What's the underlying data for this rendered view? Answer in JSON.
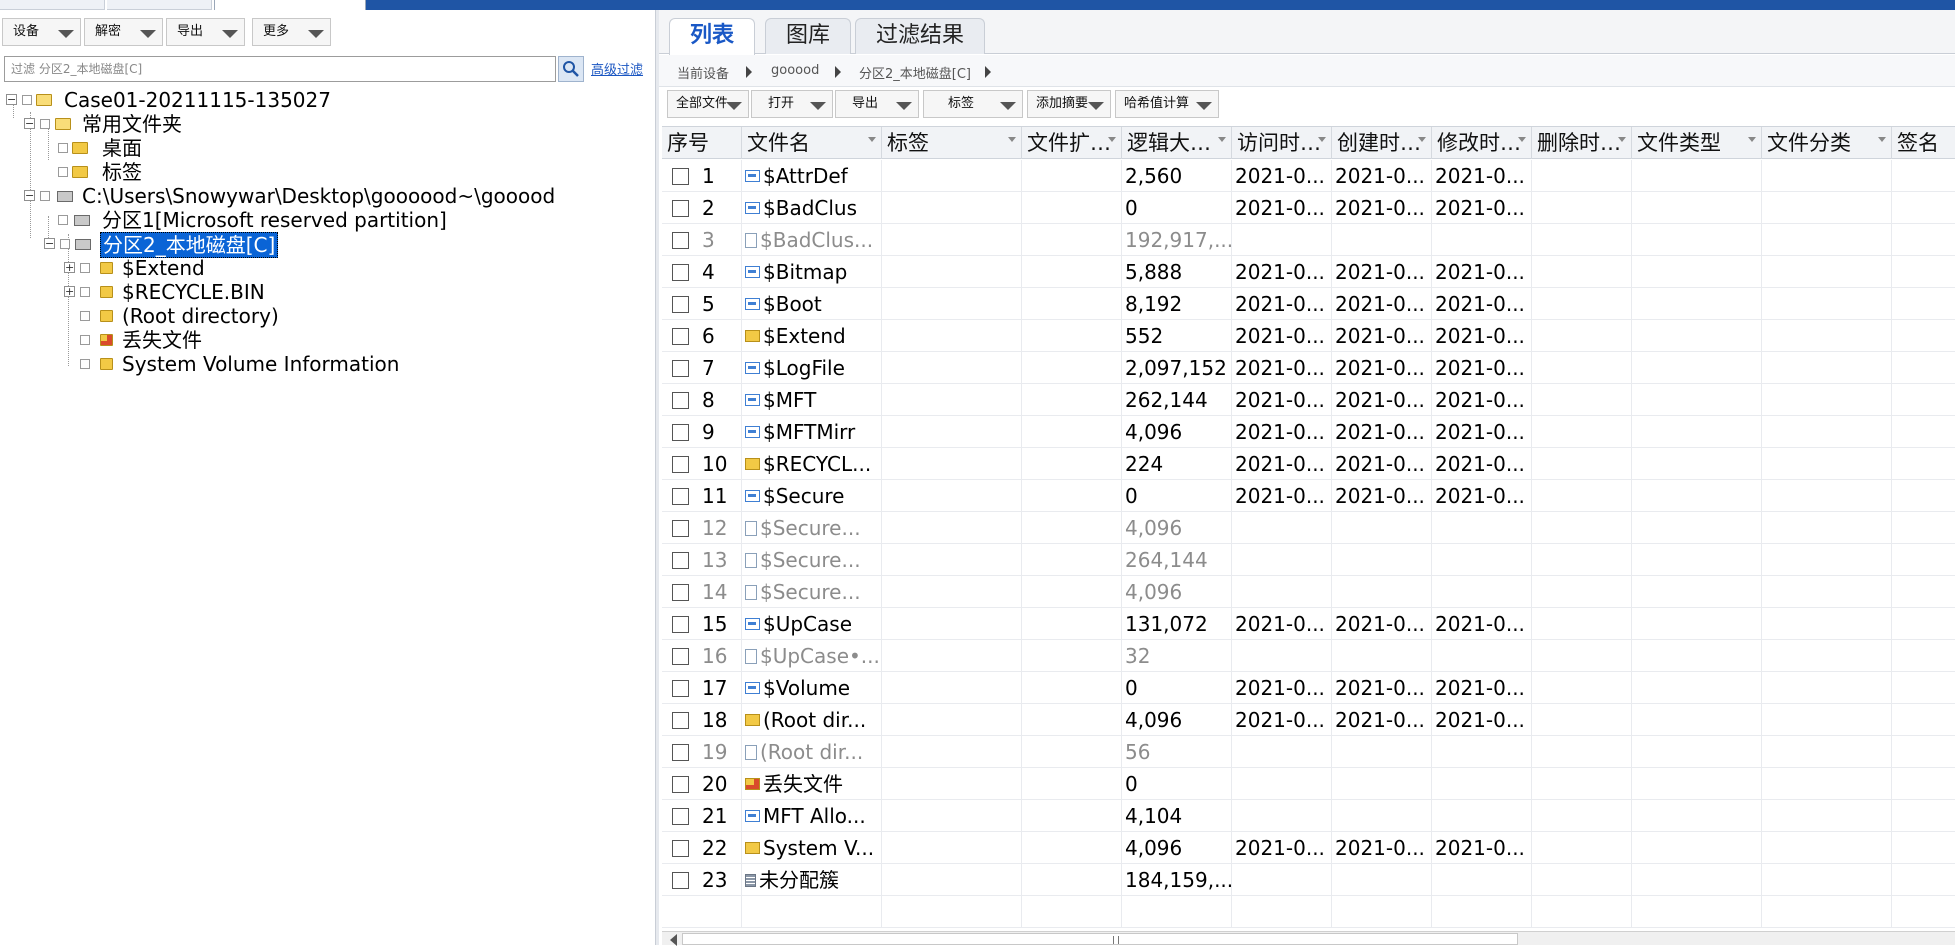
{
  "left_toolbar": {
    "device": "设备",
    "decrypt": "解密",
    "export": "导出",
    "more": "更多"
  },
  "filter": {
    "placeholder": "过滤 分区2_本地磁盘[C]",
    "advanced": "高级过滤"
  },
  "tree": {
    "case": "Case01-20211115-135027",
    "common_folder": "常用文件夹",
    "desktop": "桌面",
    "tags": "标签",
    "image_path": "C:\\Users\\Snowywar\\Desktop\\goooood~\\gooood",
    "partition1": "分区1[Microsoft reserved partition]",
    "partition2": "分区2_本地磁盘[C]",
    "extend": "$Extend",
    "recycle": "$RECYCLE.BIN",
    "root": "(Root directory)",
    "lost": "丢失文件",
    "svi": "System Volume Information"
  },
  "tabs": {
    "list": "列表",
    "gallery": "图库",
    "filter_result": "过滤结果"
  },
  "breadcrumb": [
    "当前设备",
    "gooood",
    "分区2_本地磁盘[C]"
  ],
  "right_toolbar": {
    "all_files": "全部文件",
    "open": "打开",
    "export": "导出",
    "tag": "标签",
    "add_summary": "添加摘要",
    "hash": "哈希值计算"
  },
  "columns": [
    "序号",
    "文件名",
    "标签",
    "文件扩…",
    "逻辑大…",
    "访问时…",
    "创建时…",
    "修改时…",
    "删除时…",
    "文件类型",
    "文件分类",
    "签名"
  ],
  "rows": [
    {
      "n": "1",
      "name": "$AttrDef",
      "icon": "sys-file-icon",
      "size": "2,560",
      "a": "2021-0...",
      "c": "2021-0...",
      "m": "2021-0..."
    },
    {
      "n": "2",
      "name": "$BadClus",
      "icon": "sys-file-icon",
      "size": "0",
      "a": "2021-0...",
      "c": "2021-0...",
      "m": "2021-0..."
    },
    {
      "n": "3",
      "name": "$BadClus...",
      "icon": "document-icon",
      "size": "192,917,...",
      "a": "",
      "c": "",
      "m": ""
    },
    {
      "n": "4",
      "name": "$Bitmap",
      "icon": "sys-file-icon",
      "size": "5,888",
      "a": "2021-0...",
      "c": "2021-0...",
      "m": "2021-0..."
    },
    {
      "n": "5",
      "name": "$Boot",
      "icon": "sys-file-icon",
      "size": "8,192",
      "a": "2021-0...",
      "c": "2021-0...",
      "m": "2021-0..."
    },
    {
      "n": "6",
      "name": "$Extend",
      "icon": "folder-icon",
      "size": "552",
      "a": "2021-0...",
      "c": "2021-0...",
      "m": "2021-0..."
    },
    {
      "n": "7",
      "name": "$LogFile",
      "icon": "sys-file-icon",
      "size": "2,097,152",
      "a": "2021-0...",
      "c": "2021-0...",
      "m": "2021-0..."
    },
    {
      "n": "8",
      "name": "$MFT",
      "icon": "sys-file-icon",
      "size": "262,144",
      "a": "2021-0...",
      "c": "2021-0...",
      "m": "2021-0..."
    },
    {
      "n": "9",
      "name": "$MFTMirr",
      "icon": "sys-file-icon",
      "size": "4,096",
      "a": "2021-0...",
      "c": "2021-0...",
      "m": "2021-0..."
    },
    {
      "n": "10",
      "name": "$RECYCL...",
      "icon": "folder-icon",
      "size": "224",
      "a": "2021-0...",
      "c": "2021-0...",
      "m": "2021-0..."
    },
    {
      "n": "11",
      "name": "$Secure",
      "icon": "sys-file-icon",
      "size": "0",
      "a": "2021-0...",
      "c": "2021-0...",
      "m": "2021-0..."
    },
    {
      "n": "12",
      "name": "$Secure...",
      "icon": "document-icon",
      "size": "4,096",
      "a": "",
      "c": "",
      "m": ""
    },
    {
      "n": "13",
      "name": "$Secure...",
      "icon": "document-icon",
      "size": "264,144",
      "a": "",
      "c": "",
      "m": ""
    },
    {
      "n": "14",
      "name": "$Secure...",
      "icon": "document-icon",
      "size": "4,096",
      "a": "",
      "c": "",
      "m": ""
    },
    {
      "n": "15",
      "name": "$UpCase",
      "icon": "sys-file-icon",
      "size": "131,072",
      "a": "2021-0...",
      "c": "2021-0...",
      "m": "2021-0..."
    },
    {
      "n": "16",
      "name": "$UpCase•...",
      "icon": "document-icon",
      "size": "32",
      "a": "",
      "c": "",
      "m": ""
    },
    {
      "n": "17",
      "name": "$Volume",
      "icon": "sys-file-icon",
      "size": "0",
      "a": "2021-0...",
      "c": "2021-0...",
      "m": "2021-0..."
    },
    {
      "n": "18",
      "name": "(Root dir...",
      "icon": "folder-icon",
      "size": "4,096",
      "a": "2021-0...",
      "c": "2021-0...",
      "m": "2021-0..."
    },
    {
      "n": "19",
      "name": "(Root dir...",
      "icon": "document-icon",
      "size": "56",
      "a": "",
      "c": "",
      "m": ""
    },
    {
      "n": "20",
      "name": "丢失文件",
      "icon": "lost-folder-icon",
      "size": "0",
      "a": "",
      "c": "",
      "m": ""
    },
    {
      "n": "21",
      "name": "MFT Allo...",
      "icon": "sys-file-icon",
      "size": "4,104",
      "a": "",
      "c": "",
      "m": ""
    },
    {
      "n": "22",
      "name": "System V...",
      "icon": "folder-icon",
      "size": "4,096",
      "a": "2021-0...",
      "c": "2021-0...",
      "m": "2021-0..."
    },
    {
      "n": "23",
      "name": "未分配簇",
      "icon": "unallocated-icon",
      "size": "184,159,...",
      "a": "",
      "c": "",
      "m": ""
    }
  ],
  "gray_rows": [
    "3",
    "12",
    "13",
    "14",
    "16",
    "19"
  ]
}
